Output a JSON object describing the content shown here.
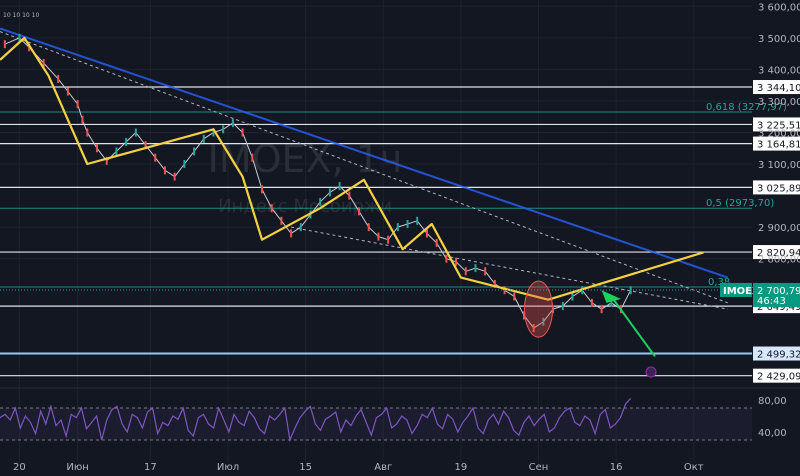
{
  "chart_data": {
    "type": "line",
    "title": "",
    "symbol": "IMOEX",
    "watermark_symbol": "IMOEX, 1ч",
    "watermark_name": "Индекс Мосбиржи",
    "top_left_text": "10 10 10 10",
    "ylim": [
      2390,
      3620
    ],
    "yticks": [
      3600,
      3500,
      3400,
      3300,
      3200,
      3100,
      2900,
      2800
    ],
    "ytick_labels": [
      "3 600,00",
      "3 500,00",
      "3 400,00",
      "3 300,00",
      "3 200,00",
      "3 100,00",
      "2 900,00",
      "2 800,00"
    ],
    "x_labels": [
      "20",
      "Июн",
      "17",
      "Июл",
      "15",
      "Авг",
      "19",
      "Сен",
      "16",
      "Окт"
    ],
    "x_label_index": [
      0,
      12,
      27,
      43,
      59,
      75,
      91,
      107,
      123,
      139
    ],
    "x_index_range": [
      -4,
      151
    ],
    "horizontal_levels": [
      {
        "value": 3344.1,
        "label": "3 344,10"
      },
      {
        "value": 3225.51,
        "label": "3 225,51"
      },
      {
        "value": 3164.81,
        "label": "3 164,81"
      },
      {
        "value": 3025.89,
        "label": "3 025,89"
      },
      {
        "value": 2820.94,
        "label": "2 820,94"
      },
      {
        "value": 2649.49,
        "label": "2 649,49"
      },
      {
        "value": 2499.32,
        "label": "2 499,32"
      },
      {
        "value": 2429.09,
        "label": "2 429,09"
      }
    ],
    "fib_levels": [
      {
        "value": 3265.0,
        "label": "0,618 (3277,97)"
      },
      {
        "value": 2960.0,
        "label": "0,5 (2973,70)"
      },
      {
        "value": 2710.0,
        "label": "0,38"
      }
    ],
    "last_price": {
      "value": 2700.79,
      "label": "2 700,79",
      "countdown": "46:43"
    },
    "series": [
      {
        "x": [
          -3,
          0,
          2,
          5,
          8,
          10,
          12,
          13,
          14,
          16,
          18,
          20,
          22,
          24,
          26,
          28,
          30,
          32,
          34,
          36,
          38,
          40,
          42,
          44,
          46,
          48,
          50,
          52,
          54,
          56,
          58,
          60,
          62,
          64,
          66,
          68,
          70,
          72,
          74,
          76,
          78,
          80,
          82,
          84,
          86,
          88,
          90,
          92,
          94,
          96,
          98,
          100,
          102,
          104,
          106,
          108,
          110,
          112,
          114,
          116,
          118,
          120,
          122,
          124,
          126
        ],
        "values": [
          3480,
          3500,
          3470,
          3420,
          3370,
          3330,
          3290,
          3240,
          3200,
          3150,
          3110,
          3140,
          3170,
          3200,
          3160,
          3120,
          3080,
          3060,
          3100,
          3140,
          3180,
          3200,
          3210,
          3230,
          3200,
          3120,
          3020,
          2960,
          2920,
          2880,
          2900,
          2940,
          2980,
          3010,
          3030,
          3000,
          2950,
          2900,
          2870,
          2860,
          2900,
          2910,
          2920,
          2880,
          2850,
          2800,
          2790,
          2760,
          2770,
          2760,
          2720,
          2700,
          2680,
          2620,
          2580,
          2600,
          2640,
          2650,
          2680,
          2700,
          2660,
          2640,
          2660,
          2640,
          2700
        ]
      }
    ],
    "yellow_zigzag_x": [
      -4,
      1,
      6,
      14,
      40,
      46,
      50,
      62,
      71,
      79,
      85,
      91,
      109,
      141
    ],
    "yellow_zigzag_y": [
      3430,
      3500,
      3380,
      3100,
      3210,
      3060,
      2860,
      2960,
      3050,
      2830,
      2910,
      2740,
      2670,
      2820
    ],
    "indicator": {
      "type": "rsi",
      "ylim": [
        15,
        95
      ],
      "yticks": [
        80,
        40
      ],
      "ytick_labels": [
        "80,00",
        "40,00"
      ],
      "values": [
        58,
        62,
        55,
        70,
        45,
        60,
        52,
        38,
        66,
        50,
        72,
        48,
        55,
        35,
        62,
        58,
        70,
        44,
        52,
        60,
        30,
        55,
        68,
        72,
        50,
        40,
        62,
        58,
        45,
        65,
        70,
        38,
        52,
        48,
        60,
        56,
        70,
        42,
        35,
        58,
        62,
        50,
        45,
        70,
        55,
        40,
        62,
        52,
        48,
        66,
        58,
        44,
        38,
        60,
        55,
        62,
        70,
        30,
        45,
        58,
        66,
        72,
        50,
        42,
        56,
        60,
        65,
        40,
        55,
        48,
        60,
        68,
        52,
        36,
        58,
        62,
        70,
        45,
        50,
        60,
        55,
        38,
        48,
        62,
        58,
        70,
        50,
        44,
        62,
        56,
        40,
        52,
        60,
        70,
        45,
        38,
        55,
        62,
        50,
        66,
        58,
        42,
        36,
        52,
        60,
        48,
        56,
        62,
        40,
        45,
        58,
        66,
        70,
        52,
        48,
        60,
        55,
        38,
        62,
        68,
        45,
        50,
        58,
        75,
        82
      ]
    }
  }
}
